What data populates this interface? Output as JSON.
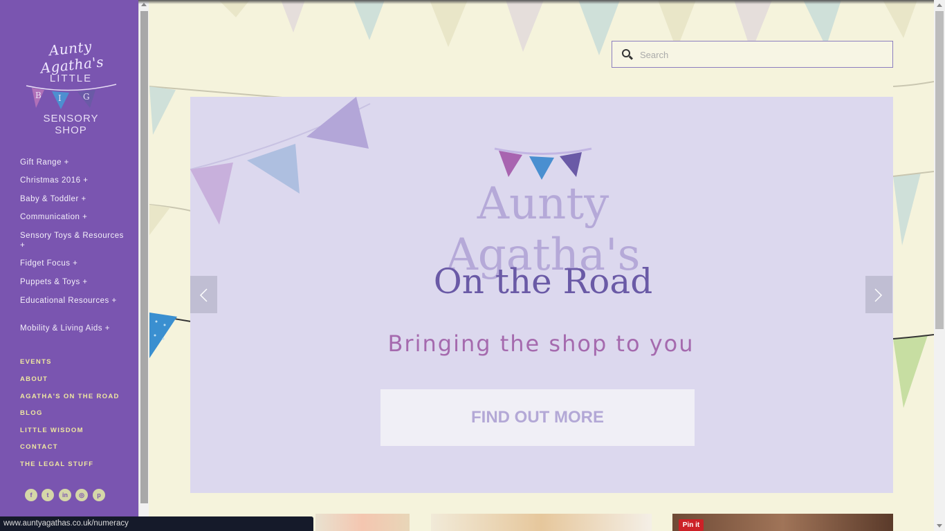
{
  "logo": {
    "script": "Aunty Agatha's",
    "little": "LITTLE",
    "line1": "SENSORY",
    "line2": "SHOP"
  },
  "nav_categories": [
    "Gift Range +",
    "Christmas 2016 +",
    "Baby & Toddler +",
    "Communication +",
    "Sensory Toys & Resources +",
    "Fidget Focus +",
    "Puppets & Toys +",
    "Educational Resources +",
    "Mobility & Living Aids +"
  ],
  "nav_sections": [
    "EVENTS",
    "ABOUT",
    "AGATHA'S ON THE ROAD",
    "BLOG",
    "LITTLE WISDOM",
    "CONTACT",
    "THE LEGAL STUFF"
  ],
  "social": [
    {
      "icon": "facebook-icon",
      "glyph": "f"
    },
    {
      "icon": "twitter-icon",
      "glyph": "t"
    },
    {
      "icon": "linkedin-icon",
      "glyph": "in"
    },
    {
      "icon": "instagram-icon",
      "glyph": "◎"
    },
    {
      "icon": "pinterest-icon",
      "glyph": "p"
    }
  ],
  "search": {
    "placeholder": "Search"
  },
  "slide": {
    "title": "Aunty Agatha's",
    "subtitle": "On the Road",
    "tagline": "Bringing the shop to you",
    "button": "FIND OUT MORE"
  },
  "pinit": "Pin it",
  "status_url": "www.auntyagathas.co.uk/numeracy",
  "colors": {
    "sidebar": "#7a55b0",
    "background": "#f5f3dc",
    "slide_bg": "#dcd8ee",
    "nav_section": "#efe8a0"
  }
}
